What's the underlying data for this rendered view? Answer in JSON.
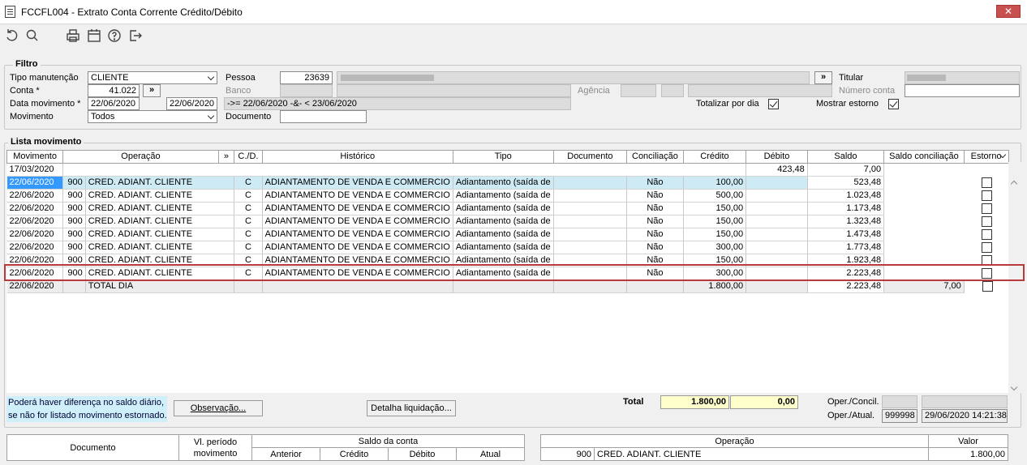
{
  "window": {
    "title": "FCCFL004 - Extrato Conta Corrente Crédito/Débito",
    "close": "✕"
  },
  "filtro": {
    "legend": "Filtro",
    "tipo_manutencao_label": "Tipo manutenção",
    "tipo_manutencao_value": "CLIENTE",
    "conta_label": "Conta *",
    "conta_value": "41.022",
    "data_movimento_label": "Data movimento *",
    "data_de": "22/06/2020",
    "data_ate": "22/06/2020",
    "data_expr": "->= 22/06/2020 -&- < 23/06/2020",
    "movimento_label": "Movimento",
    "movimento_value": "Todos",
    "pessoa_label": "Pessoa",
    "pessoa_value": "23639",
    "banco_label": "Banco",
    "agencia_label": "Agência",
    "numero_conta_label": "Número conta",
    "documento_label": "Documento",
    "titular_label": "Titular",
    "totalizar_label": "Totalizar por dia",
    "mostrar_estorno_label": "Mostrar estorno",
    "btn_arrow": "»"
  },
  "lista": {
    "legend": "Lista movimento",
    "headers": [
      "Movimento",
      "Operação",
      "»",
      "C./D.",
      "Histórico",
      "Tipo",
      "Documento",
      "Conciliação",
      "Crédito",
      "Débito",
      "Saldo",
      "Saldo conciliação",
      "Estorno"
    ],
    "opening": {
      "date": "17/03/2020",
      "saldo": "423,48",
      "saldo_conc": "7,00"
    },
    "rows": [
      {
        "date": "22/06/2020",
        "op_code": "900",
        "op": "CRED. ADIANT. CLIENTE",
        "cd": "C",
        "hist": "ADIANTAMENTO DE VENDA E COMMERCIO",
        "tipo": "Adiantamento (saída de",
        "conc": "Não",
        "credito": "100,00",
        "saldo": "523,48"
      },
      {
        "date": "22/06/2020",
        "op_code": "900",
        "op": "CRED. ADIANT. CLIENTE",
        "cd": "C",
        "hist": "ADIANTAMENTO DE VENDA E COMMERCIO",
        "tipo": "Adiantamento (saída de",
        "conc": "Não",
        "credito": "500,00",
        "saldo": "1.023,48"
      },
      {
        "date": "22/06/2020",
        "op_code": "900",
        "op": "CRED. ADIANT. CLIENTE",
        "cd": "C",
        "hist": "ADIANTAMENTO DE VENDA E COMMERCIO",
        "tipo": "Adiantamento (saída de",
        "conc": "Não",
        "credito": "150,00",
        "saldo": "1.173,48"
      },
      {
        "date": "22/06/2020",
        "op_code": "900",
        "op": "CRED. ADIANT. CLIENTE",
        "cd": "C",
        "hist": "ADIANTAMENTO DE VENDA E COMMERCIO",
        "tipo": "Adiantamento (saída de",
        "conc": "Não",
        "credito": "150,00",
        "saldo": "1.323,48"
      },
      {
        "date": "22/06/2020",
        "op_code": "900",
        "op": "CRED. ADIANT. CLIENTE",
        "cd": "C",
        "hist": "ADIANTAMENTO DE VENDA E COMMERCIO",
        "tipo": "Adiantamento (saída de",
        "conc": "Não",
        "credito": "150,00",
        "saldo": "1.473,48"
      },
      {
        "date": "22/06/2020",
        "op_code": "900",
        "op": "CRED. ADIANT. CLIENTE",
        "cd": "C",
        "hist": "ADIANTAMENTO DE VENDA E COMMERCIO",
        "tipo": "Adiantamento (saída de",
        "conc": "Não",
        "credito": "300,00",
        "saldo": "1.773,48"
      },
      {
        "date": "22/06/2020",
        "op_code": "900",
        "op": "CRED. ADIANT. CLIENTE",
        "cd": "C",
        "hist": "ADIANTAMENTO DE VENDA E COMMERCIO",
        "tipo": "Adiantamento (saída de",
        "conc": "Não",
        "credito": "150,00",
        "saldo": "1.923,48"
      },
      {
        "date": "22/06/2020",
        "op_code": "900",
        "op": "CRED. ADIANT. CLIENTE",
        "cd": "C",
        "hist": "ADIANTAMENTO DE VENDA E COMMERCIO",
        "tipo": "Adiantamento (saída de",
        "conc": "Não",
        "credito": "300,00",
        "saldo": "2.223,48"
      }
    ],
    "total": {
      "date": "22/06/2020",
      "label": "TOTAL DIA",
      "credito": "1.800,00",
      "saldo": "2.223,48",
      "saldo_conc": "7,00"
    }
  },
  "footer": {
    "note_line1": "Poderá haver diferença no saldo diário,",
    "note_line2": "se não for listado movimento estornado.",
    "btn_observacao": "Observação...",
    "btn_detalha": "Detalha liquidação...",
    "total_label": "Total",
    "total_credito": "1.800,00",
    "total_debito": "0,00",
    "oper_concil_label": "Oper./Concil.",
    "oper_atual_label": "Oper./Atual.",
    "oper_atual_user": "999998",
    "oper_atual_ts": "29/06/2020 14:21:38"
  },
  "bottom_left": {
    "h_documento": "Documento",
    "h_periodo": "Vl. período movimento",
    "h_saldo": "Saldo da conta",
    "h_anterior": "Anterior",
    "h_credito": "Crédito",
    "h_debito": "Débito",
    "h_atual": "Atual"
  },
  "bottom_right": {
    "h_operacao": "Operação",
    "h_valor": "Valor",
    "op_code": "900",
    "op_name": "CRED. ADIANT. CLIENTE",
    "valor": "1.800,00"
  }
}
